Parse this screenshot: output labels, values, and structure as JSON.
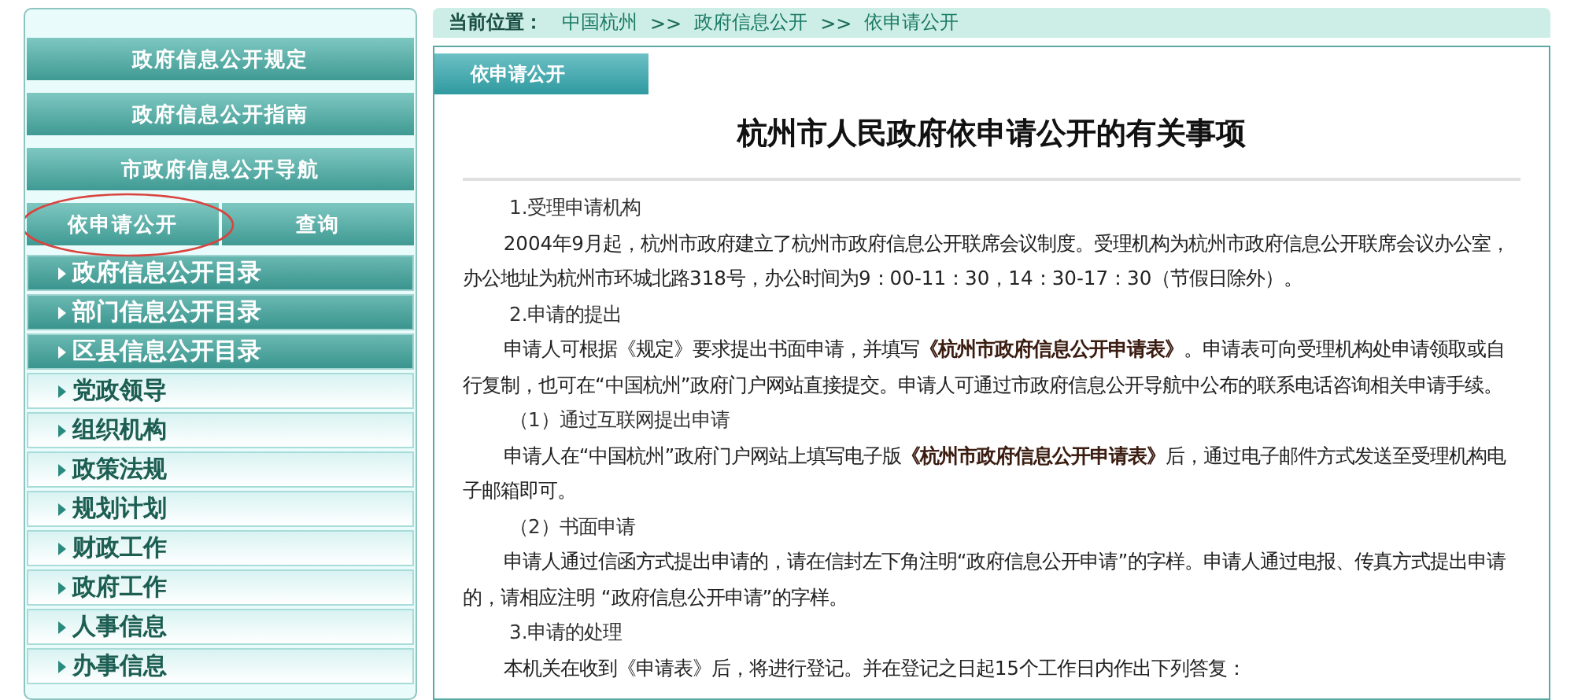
{
  "sidebar": {
    "buttons": [
      {
        "label": "政府信息公开规定"
      },
      {
        "label": "政府信息公开指南"
      },
      {
        "label": "市政府信息公开导航"
      }
    ],
    "tabs": [
      {
        "label": "依申请公开",
        "circled": true
      },
      {
        "label": "查询",
        "circled": false
      }
    ],
    "items": [
      {
        "kind": "dark",
        "label": "政府信息公开目录"
      },
      {
        "kind": "dark",
        "label": "部门信息公开目录"
      },
      {
        "kind": "dark",
        "label": "区县信息公开目录"
      },
      {
        "kind": "light",
        "label": "党政领导"
      },
      {
        "kind": "light",
        "label": "组织机构"
      },
      {
        "kind": "light",
        "label": "政策法规"
      },
      {
        "kind": "light",
        "label": "规划计划"
      },
      {
        "kind": "light",
        "label": "财政工作"
      },
      {
        "kind": "light",
        "label": "政府工作"
      },
      {
        "kind": "light",
        "label": "人事信息"
      },
      {
        "kind": "light",
        "label": "办事信息"
      }
    ]
  },
  "breadcrumb": {
    "label": "当前位置：",
    "links": [
      "中国杭州",
      "政府信息公开",
      "依申请公开"
    ],
    "separator": ">>"
  },
  "content": {
    "tab": "依申请公开",
    "title": "杭州市人民政府依申请公开的有关事项",
    "paragraphs": [
      {
        "kind": "heading",
        "text": "1.受理申请机构"
      },
      {
        "kind": "text",
        "text": "2004年9月起，杭州市政府建立了杭州市政府信息公开联席会议制度。受理机构为杭州市政府信息公开联席会议办公室，办公地址为杭州市环城北路318号，办公时间为9：00-11：30，14：30-17：30（节假日除外）。"
      },
      {
        "kind": "heading",
        "text": "2.申请的提出"
      },
      {
        "kind": "text",
        "text": "申请人可根据《规定》要求提出书面申请，并填写**《杭州市政府信息公开申请表》**。申请表可向受理机构处申请领取或自行复制，也可在“中国杭州”政府门户网站直接提交。申请人可通过市政府信息公开导航中公布的联系电话咨询相关申请手续。"
      },
      {
        "kind": "heading",
        "text": "（1）通过互联网提出申请"
      },
      {
        "kind": "text",
        "text": "申请人在“中国杭州”政府门户网站上填写电子版**《杭州市政府信息公开申请表》**后，通过电子邮件方式发送至受理机构电子邮箱即可。"
      },
      {
        "kind": "heading",
        "text": "（2）书面申请"
      },
      {
        "kind": "text",
        "text": "申请人通过信函方式提出申请的，请在信封左下角注明“政府信息公开申请”的字样。申请人通过电报、传真方式提出申请的，请相应注明 “政府信息公开申请”的字样。"
      },
      {
        "kind": "heading",
        "text": "3.申请的处理"
      },
      {
        "kind": "text",
        "text": "本机关在收到《申请表》后，将进行登记。并在登记之日起15个工作日内作出下列答复："
      }
    ]
  }
}
